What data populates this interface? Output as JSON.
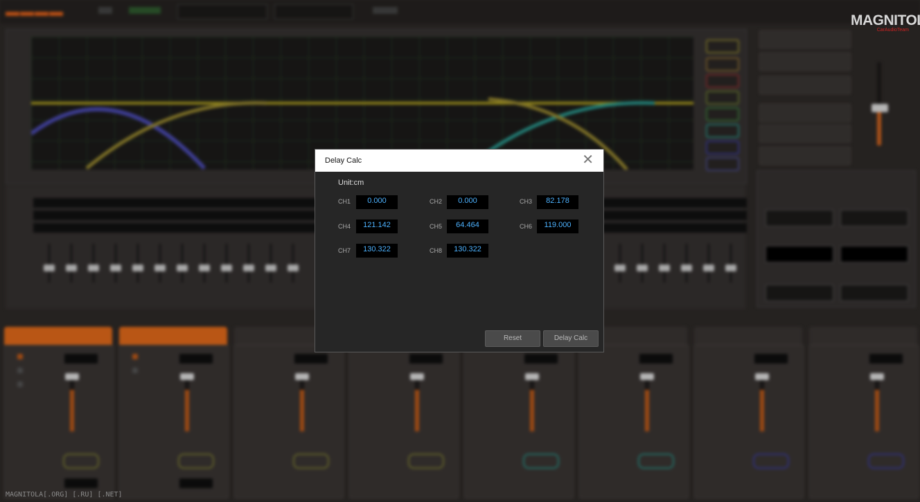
{
  "dialog": {
    "title": "Delay Calc",
    "close_glyph": "✕",
    "unit_label": "Unit:cm",
    "channels": [
      {
        "label": "CH1",
        "value": "0.000"
      },
      {
        "label": "CH2",
        "value": "0.000"
      },
      {
        "label": "CH3",
        "value": "82.178"
      },
      {
        "label": "CH4",
        "value": "121.142"
      },
      {
        "label": "CH5",
        "value": "64.464"
      },
      {
        "label": "CH6",
        "value": "119.000"
      },
      {
        "label": "CH7",
        "value": "130.322"
      },
      {
        "label": "CH8",
        "value": "130.322"
      }
    ],
    "reset_label": "Reset",
    "calc_label": "Delay Calc"
  },
  "watermark": "MAGNITOLA[.ORG] [.RU] [.NET]",
  "brand": {
    "main": "MAGNITOLA",
    "sub": "CarAudioTeam"
  },
  "colors": {
    "accent": "#d0641f",
    "value_text": "#4db2ff",
    "dialog_bg": "#262626"
  }
}
